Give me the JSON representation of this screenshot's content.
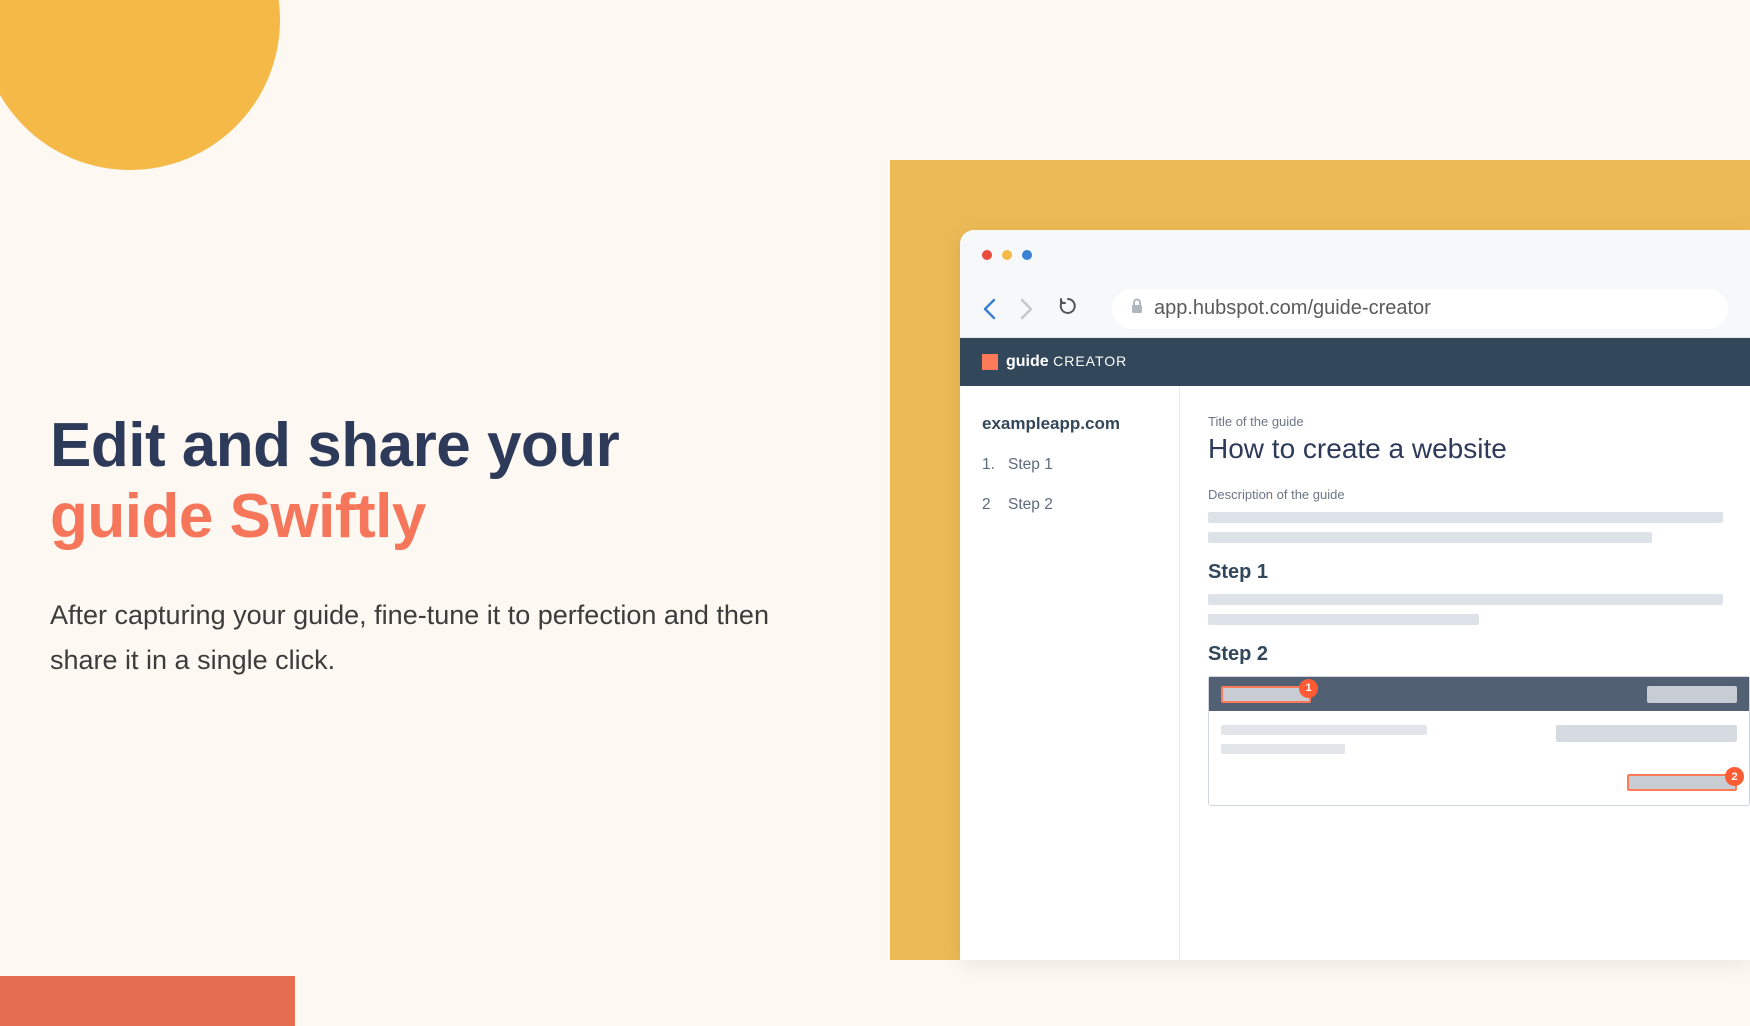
{
  "hero": {
    "headline_line1": "Edit and share your",
    "headline_line2": "guide Swiftly",
    "subtext": "After capturing your guide, fine-tune it to perfection and then share it in a single click."
  },
  "browser": {
    "url": "app.hubspot.com/guide-creator"
  },
  "app": {
    "logo_bold": "guide",
    "logo_light": "CREATOR",
    "sidebar": {
      "domain": "exampleapp.com",
      "items": [
        {
          "num": "1.",
          "label": "Step 1"
        },
        {
          "num": "2",
          "label": "Step 2"
        }
      ]
    },
    "main": {
      "title_label": "Title of the guide",
      "title_value": "How to create a website",
      "description_label": "Description of the guide",
      "step1_heading": "Step 1",
      "step2_heading": "Step 2",
      "badge1": "1",
      "badge2": "2"
    }
  }
}
